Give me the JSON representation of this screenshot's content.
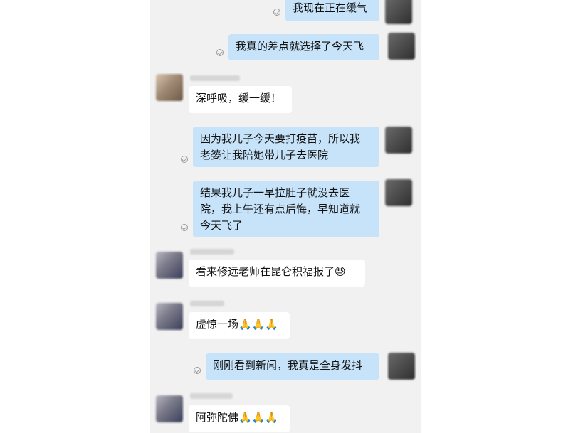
{
  "messages": [
    {
      "id": "m1",
      "dir": "out",
      "text": "我现在正在缓气"
    },
    {
      "id": "m2",
      "dir": "out",
      "text": "我真的差点就选择了今天飞"
    },
    {
      "id": "m3",
      "dir": "in",
      "text": "深呼吸，缓一缓！"
    },
    {
      "id": "m4",
      "dir": "out",
      "text": "因为我儿子今天要打疫苗，所以我\n老婆让我陪她带儿子去医院"
    },
    {
      "id": "m5",
      "dir": "out",
      "text": "结果我儿子一早拉肚子就没去医\n院，我上午还有点后悔，早知道就\n今天飞了"
    },
    {
      "id": "m6",
      "dir": "in",
      "text": "看来修远老师在昆仑积福报了😓"
    },
    {
      "id": "m7",
      "dir": "in",
      "text": "虚惊一场🙏🙏🙏"
    },
    {
      "id": "m8",
      "dir": "out",
      "text": "刚刚看到新闻，我真是全身发抖"
    },
    {
      "id": "m9",
      "dir": "in",
      "text": "阿弥陀佛🙏🙏🙏"
    }
  ],
  "colors": {
    "chat_background": "#f1f1f1",
    "outgoing_bubble": "#c6e3fa",
    "incoming_bubble": "#ffffff"
  },
  "icons": {
    "read_receipt": "check-circle-icon"
  }
}
